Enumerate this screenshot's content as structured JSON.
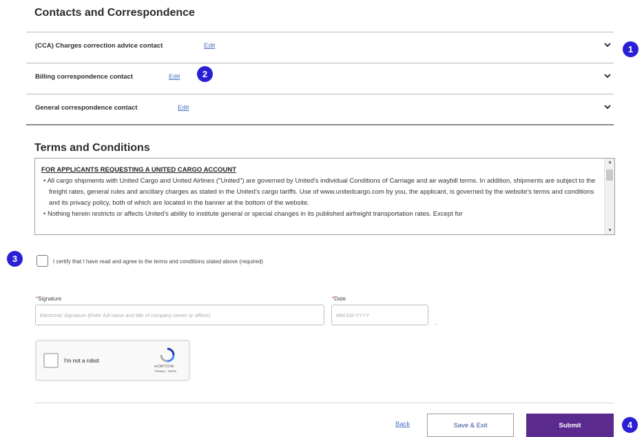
{
  "contacts": {
    "title": "Contacts and Correspondence",
    "items": [
      {
        "label": "(CCA) Charges correction advice contact",
        "edit": "Edit"
      },
      {
        "label": "Billing correspondence contact",
        "edit": "Edit"
      },
      {
        "label": "General correspondence contact",
        "edit": "Edit"
      }
    ]
  },
  "terms": {
    "title": "Terms and Conditions",
    "heading": "FOR APPLICANTS REQUESTING A UNITED CARGO ACCOUNT",
    "bullets": [
      "• All cargo shipments with United Cargo and United Airlines (\"United\") are governed by United's individual Conditions of Carriage and air waybill terms. In addition, shipments are subject to the freight rates, general rules and ancillary charges as stated in the United's cargo tariffs. Use of www.unitedcargo.com by you, the applicant, is governed by the website's terms and conditions and its privacy policy, both of which are located in the banner at the bottom of the website.",
      "• Nothing herein restricts or affects United's ability to institute general or special changes in its published airfreight transportation rates. Except for"
    ]
  },
  "certify": {
    "label": "I certify that I have read and agree to the terms and conditions stated above (required)"
  },
  "signature": {
    "label": "Signature",
    "required_mark": "*",
    "placeholder": "Electronic Signature (Enter full name and title of company owner or officer)"
  },
  "date": {
    "label": "Date",
    "required_mark": "*",
    "placeholder": "MM-DD-YYYY",
    "note": "*"
  },
  "recaptcha": {
    "label": "I'm not a robot",
    "brand": "reCAPTCHA",
    "links": "Privacy - Terms"
  },
  "actions": {
    "back": "Back",
    "save_exit": "Save & Exit",
    "submit": "Submit"
  },
  "badges": [
    "1",
    "2",
    "3",
    "4"
  ],
  "colors": {
    "badge": "#2a1fd4",
    "submit": "#5b2a8e",
    "link": "#4a6fc2"
  }
}
